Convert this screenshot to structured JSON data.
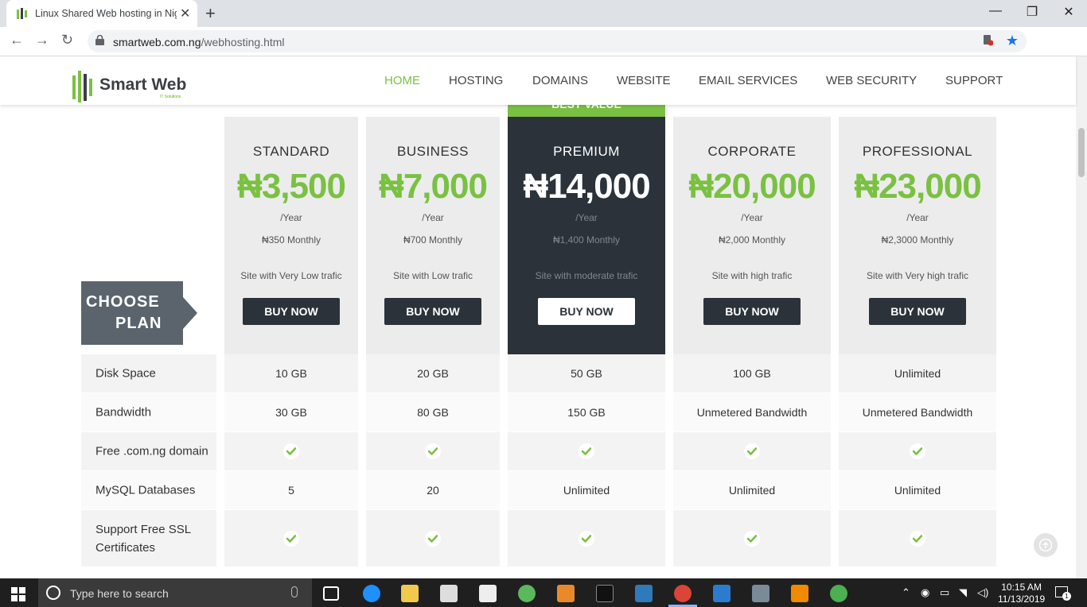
{
  "browser": {
    "tab_title": "Linux Shared Web hosting in Nig",
    "url_domain": "smartweb.com.ng",
    "url_path": "/webhosting.html"
  },
  "site": {
    "logo_name": "Smart Web",
    "logo_tagline": "IT Solutions",
    "nav": [
      "HOME",
      "HOSTING",
      "DOMAINS",
      "WEBSITE",
      "EMAIL SERVICES",
      "WEB SECURITY",
      "SUPPORT"
    ],
    "accent": "#7ac142",
    "dark": "#2b323a"
  },
  "pricing": {
    "best_value_label": "BEST VALUE",
    "choose_plan": [
      "CHOOSE",
      "PLAN"
    ],
    "plans": [
      {
        "name": "STANDARD",
        "price": "₦3,500",
        "period": "/Year",
        "monthly": "₦350 Monthly",
        "desc": "Site with Very Low trafic",
        "button": "BUY NOW"
      },
      {
        "name": "BUSINESS",
        "price": "₦7,000",
        "period": "/Year",
        "monthly": "₦700 Monthly",
        "desc": "Site with Low trafic",
        "button": "BUY NOW"
      },
      {
        "name": "PREMIUM",
        "price": "₦14,000",
        "period": "/Year",
        "monthly": "₦1,400 Monthly",
        "desc": "Site with moderate trafic",
        "button": "BUY NOW"
      },
      {
        "name": "CORPORATE",
        "price": "₦20,000",
        "period": "/Year",
        "monthly": "₦2,000 Monthly",
        "desc": "Site with high trafic",
        "button": "BUY NOW"
      },
      {
        "name": "PROFESSIONAL",
        "price": "₦23,000",
        "period": "/Year",
        "monthly": "₦2,3000 Monthly",
        "desc": "Site with Very high trafic",
        "button": "BUY NOW"
      }
    ],
    "features": [
      {
        "label": "Disk Space",
        "values": [
          "10 GB",
          "20 GB",
          "50 GB",
          "100 GB",
          "Unlimited"
        ]
      },
      {
        "label": "Bandwidth",
        "values": [
          "30 GB",
          "80 GB",
          "150 GB",
          "Unmetered Bandwidth",
          "Unmetered Bandwidth"
        ]
      },
      {
        "label": "Free .com.ng domain",
        "values": [
          "check-icon",
          "check-icon",
          "check-icon",
          "check-icon",
          "check-icon"
        ]
      },
      {
        "label": "MySQL Databases",
        "values": [
          "5",
          "20",
          "Unlimited",
          "Unlimited",
          "Unlimited"
        ]
      },
      {
        "label": "Support Free SSL Certificates",
        "values": [
          "check-icon",
          "check-icon",
          "check-icon",
          "check-icon",
          "check-icon"
        ]
      }
    ]
  },
  "taskbar": {
    "search_placeholder": "Type here to search",
    "time": "10:15 AM",
    "date": "11/13/2019",
    "notification_count": "1"
  }
}
